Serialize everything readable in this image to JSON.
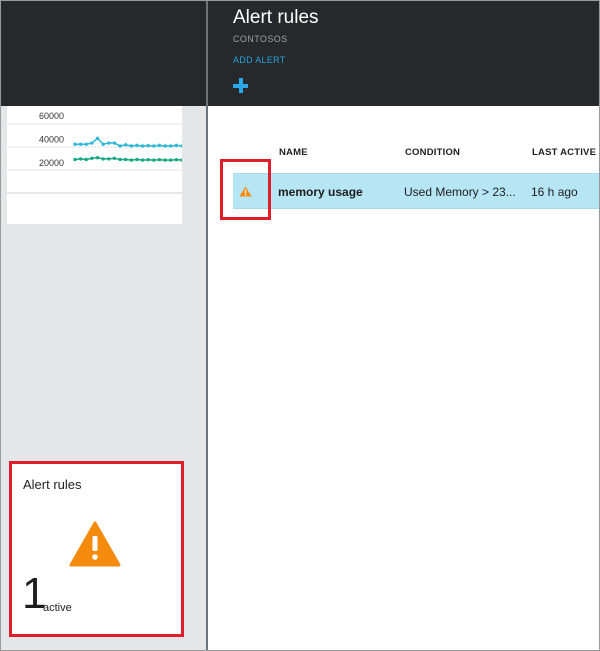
{
  "left_panel": {
    "chart_tile": {
      "chart_data": {
        "type": "line",
        "y_ticks": [
          "60000",
          "40000",
          "20000"
        ],
        "ylim": [
          0,
          70000
        ],
        "grid": true,
        "series": [
          {
            "color": "#2fb9d9",
            "values": [
              36000,
              36000,
              36000,
              37000,
              41000,
              36000,
              37000,
              37000,
              34500,
              35500,
              34500,
              35000,
              34500,
              34800,
              34500,
              35000,
              34500,
              34500,
              35000,
              34500
            ]
          },
          {
            "color": "#17a883",
            "values": [
              23000,
              23500,
              23000,
              24000,
              24500,
              23500,
              23500,
              24000,
              23000,
              23000,
              22500,
              23000,
              22500,
              22800,
              22500,
              22800,
              22500,
              22500,
              22800,
              22500
            ]
          }
        ]
      }
    },
    "alert_tile": {
      "title": "Alert rules",
      "icon": "warning-triangle-icon",
      "icon_color": "#f48b0d",
      "count": "1",
      "count_label": "active"
    }
  },
  "blade": {
    "title": "Alert rules",
    "subtitle": "CONTOSOS",
    "add_alert_label": "ADD ALERT",
    "add_icon": "plus-icon",
    "accent_color": "#2aa8e8",
    "columns": [
      "NAME",
      "CONDITION",
      "LAST ACTIVE"
    ],
    "rows": [
      {
        "icon": "warning-icon",
        "name": "memory usage",
        "condition": "Used Memory > 23...",
        "last_active": "16 h ago",
        "selected": true
      }
    ]
  },
  "colors": {
    "header_dark": "#25292b",
    "selected_row": "#b6e5f4",
    "highlight_red": "#e01d2b",
    "warning_orange": "#f48b0d"
  }
}
